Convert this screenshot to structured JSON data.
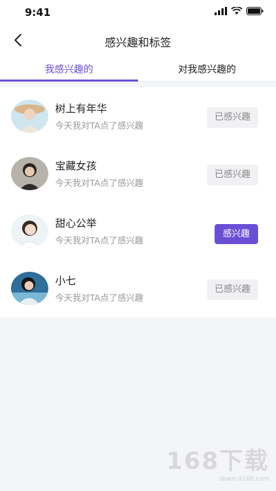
{
  "status_bar": {
    "time": "9:41"
  },
  "nav": {
    "title": "感兴趣和标签"
  },
  "tabs": [
    {
      "label": "我感兴趣的",
      "active": true
    },
    {
      "label": "对我感兴趣的",
      "active": false
    }
  ],
  "list": [
    {
      "name": "树上有年华",
      "subtitle": "今天我对TA点了感兴趣",
      "button": "已感兴趣",
      "state": "done"
    },
    {
      "name": "宝藏女孩",
      "subtitle": "今天我对TA点了感兴趣",
      "button": "已感兴趣",
      "state": "done"
    },
    {
      "name": "甜心公举",
      "subtitle": "今天我对TA点了感兴趣",
      "button": "感兴趣",
      "state": "active"
    },
    {
      "name": "小七",
      "subtitle": "今天我对TA点了感兴趣",
      "button": "已感兴趣",
      "state": "done"
    }
  ],
  "watermark": {
    "logo_text": "168下载",
    "url": "down.it168.com"
  },
  "colors": {
    "accent": "#6a4fd6",
    "background": "#f4f5f9"
  }
}
